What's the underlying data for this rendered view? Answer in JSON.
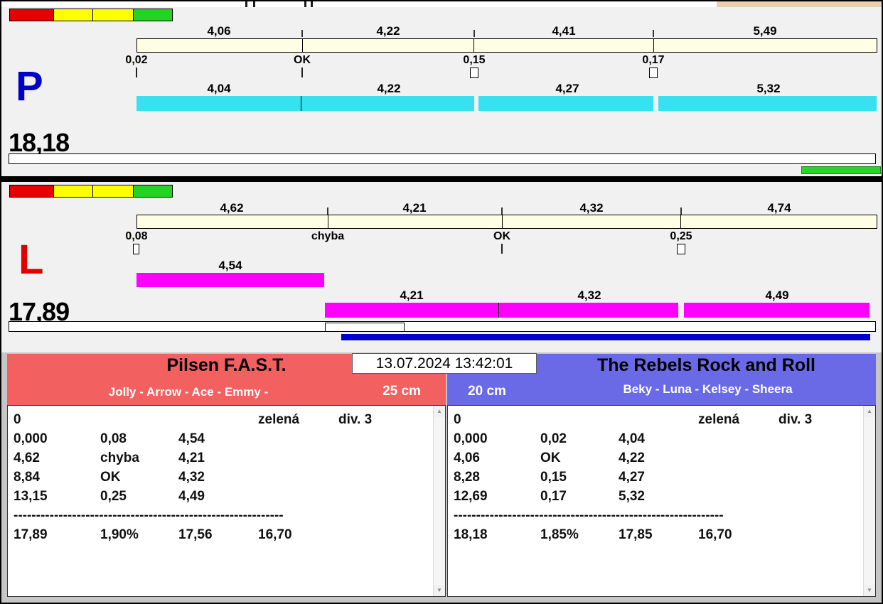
{
  "timestamp": "13.07.2024 13:42:01",
  "colors": {
    "lane_p_letter": "#0000C8",
    "lane_l_letter": "#E00000",
    "p_run_bar": "#38E1EF",
    "l_run_bar": "#FF00FF",
    "split_bar": "#FFFFE6",
    "left_header": "#F26060",
    "right_header": "#6A6AE6",
    "progress_green": "#2BD32B",
    "progress_blue": "#0000CC"
  },
  "lanes": [
    {
      "letter": "P",
      "total": "18,18",
      "split_labels": [
        "4,06",
        "4,22",
        "4,41",
        "5,49"
      ],
      "events": [
        {
          "label": "0,02",
          "marker": "line"
        },
        {
          "label": "OK",
          "marker": "line"
        },
        {
          "label": "0,15",
          "marker": "box"
        },
        {
          "label": "0,17",
          "marker": "box"
        }
      ],
      "run_labels": [
        "4,04",
        "4,22",
        "4,27",
        "5,32"
      ]
    },
    {
      "letter": "L",
      "total": "17,89",
      "split_labels": [
        "4,62",
        "4,21",
        "4,32",
        "4,74"
      ],
      "events": [
        {
          "label": "0,08",
          "marker": "box"
        },
        {
          "label": "chyba",
          "marker": "none"
        },
        {
          "label": "OK",
          "marker": "line"
        },
        {
          "label": "0,25",
          "marker": "box"
        }
      ],
      "start_run_label": "4,54",
      "run_labels": [
        "4,21",
        "4,32",
        "4,49"
      ]
    }
  ],
  "teams": [
    {
      "name": "Pilsen F.A.S.T.",
      "members": "Jolly - Arrow - Ace - Emmy -",
      "jump_height": "25 cm",
      "rows": [
        [
          "0",
          "",
          "",
          "zelená",
          "div. 3"
        ],
        [
          "0,000",
          "0,08",
          "4,54",
          "",
          ""
        ],
        [
          "4,62",
          "chyba",
          "4,21",
          "",
          ""
        ],
        [
          "8,84",
          "OK",
          "4,32",
          "",
          ""
        ],
        [
          "13,15",
          "0,25",
          "4,49",
          "",
          ""
        ]
      ],
      "separator": "------------------------------------------------------------",
      "totals": [
        "17,89",
        "1,90%",
        "17,56",
        "16,70"
      ]
    },
    {
      "name": "The Rebels Rock and Roll",
      "members": "Beky - Luna - Kelsey - Sheera",
      "jump_height": "20 cm",
      "rows": [
        [
          "0",
          "",
          "",
          "zelená",
          "div. 3"
        ],
        [
          "0,000",
          "0,02",
          "4,04",
          "",
          ""
        ],
        [
          "4,06",
          "OK",
          "4,22",
          "",
          ""
        ],
        [
          "8,28",
          "0,15",
          "4,27",
          "",
          ""
        ],
        [
          "12,69",
          "0,17",
          "5,32",
          "",
          ""
        ]
      ],
      "separator": "------------------------------------------------------------",
      "totals": [
        "18,18",
        "1,85%",
        "17,85",
        "16,70"
      ]
    }
  ]
}
